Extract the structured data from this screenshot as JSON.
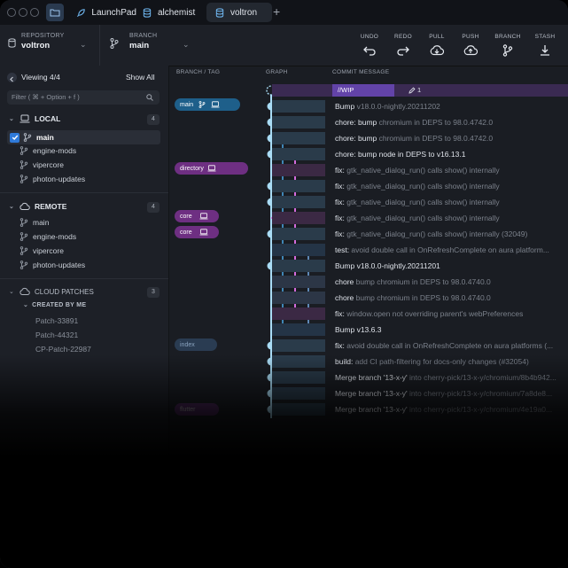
{
  "titlebar": {
    "tabs": [
      {
        "label": "LaunchPad",
        "icon": "rocket-icon"
      },
      {
        "label": "alchemist",
        "icon": "database-icon"
      },
      {
        "label": "voltron",
        "icon": "database-icon"
      }
    ],
    "plus": "+"
  },
  "toolbar": {
    "repository": {
      "label": "REPOSITORY",
      "value": "voltron"
    },
    "branch": {
      "label": "BRANCH",
      "value": "main"
    },
    "actions": [
      {
        "label": "UNDO",
        "icon": "undo-icon"
      },
      {
        "label": "REDO",
        "icon": "redo-icon"
      },
      {
        "label": "PULL",
        "icon": "pull-icon"
      },
      {
        "label": "PUSH",
        "icon": "push-icon"
      },
      {
        "label": "BRANCH",
        "icon": "branch-icon"
      },
      {
        "label": "STASH",
        "icon": "stash-icon"
      }
    ]
  },
  "sidebar": {
    "viewing": "Viewing 4/4",
    "show_all": "Show All",
    "filter_placeholder": "Filter ( ⌘ + Option + f )",
    "local": {
      "title": "LOCAL",
      "count": "4",
      "items": [
        "main",
        "engine-mods",
        "vipercore",
        "photon-updates"
      ]
    },
    "remote": {
      "title": "REMOTE",
      "count": "4",
      "items": [
        "main",
        "engine-mods",
        "vipercore",
        "photon-updates"
      ]
    },
    "cloud": {
      "title": "CLOUD PATCHES",
      "count": "3",
      "created_by_me": "CREATED BY ME",
      "items": [
        "Patch-33891",
        "Patch-44321",
        "CP-Patch-22987"
      ]
    }
  },
  "columns": {
    "branch_tag": "BRANCH / TAG",
    "graph": "GRAPH",
    "commit_message": "COMMIT MESSAGE"
  },
  "wip": {
    "label": "//WIP",
    "edits": "1"
  },
  "branch_badges": [
    "main",
    "directory",
    "core",
    "core",
    "index",
    "flutter"
  ],
  "commits": [
    {
      "summary": "Bump",
      "detail": " v18.0.0-nightly.20211202"
    },
    {
      "summary": "chore: bump",
      "detail": " chromium in DEPS to 98.0.4742.0"
    },
    {
      "summary": "chore: bump",
      "detail": " chromium in DEPS to 98.0.4742.0"
    },
    {
      "summary": "chore: bump node in DEPS to v16.13.1",
      "detail": ""
    },
    {
      "summary": "fix:",
      "detail": " gtk_native_dialog_run() calls show() internally"
    },
    {
      "summary": "fix:",
      "detail": " gtk_native_dialog_run() calls show() internally"
    },
    {
      "summary": "fix:",
      "detail": " gtk_native_dialog_run() calls show() internally"
    },
    {
      "summary": "fix:",
      "detail": " gtk_native_dialog_run() calls show() internally"
    },
    {
      "summary": "fix:",
      "detail": " gtk_native_dialog_run() calls show() internally (32049)"
    },
    {
      "summary": "test:",
      "detail": " avoid double call in OnRefreshComplete on aura platform..."
    },
    {
      "summary": "Bump v18.0.0-nightly.20211201",
      "detail": ""
    },
    {
      "summary": "chore",
      "detail": " bump chromium in DEPS to 98.0.4740.0"
    },
    {
      "summary": "chore",
      "detail": " bump chromium in DEPS to 98.0.4740.0"
    },
    {
      "summary": "fix:",
      "detail": " window.open not overriding parent's webPreferences"
    },
    {
      "summary": "Bump v13.6.3",
      "detail": ""
    },
    {
      "summary": "fix:",
      "detail": " avoid double call in OnRefreshComplete on aura platforms (..."
    },
    {
      "summary": "build:",
      "detail": " add CI path-filtering for docs-only changes (#32054)"
    },
    {
      "summary": "Merge branch '13-x-y'",
      "detail": " into cherry-pick/13-x-y/chromium/8b4b942..."
    },
    {
      "summary": "Merge branch '13-x-y'",
      "detail": " into cherry-pick/13-x-y/chromium/7a8de8..."
    },
    {
      "summary": "Merge branch '13-x-y'",
      "detail": " into cherry-pick/13-x-y/chromium/4e19a0..."
    }
  ],
  "colors": {
    "blue": "#a9dcf5",
    "purple": "#e07ae6",
    "wip": "#6243a8",
    "selected_check": "#2f7ad9"
  }
}
